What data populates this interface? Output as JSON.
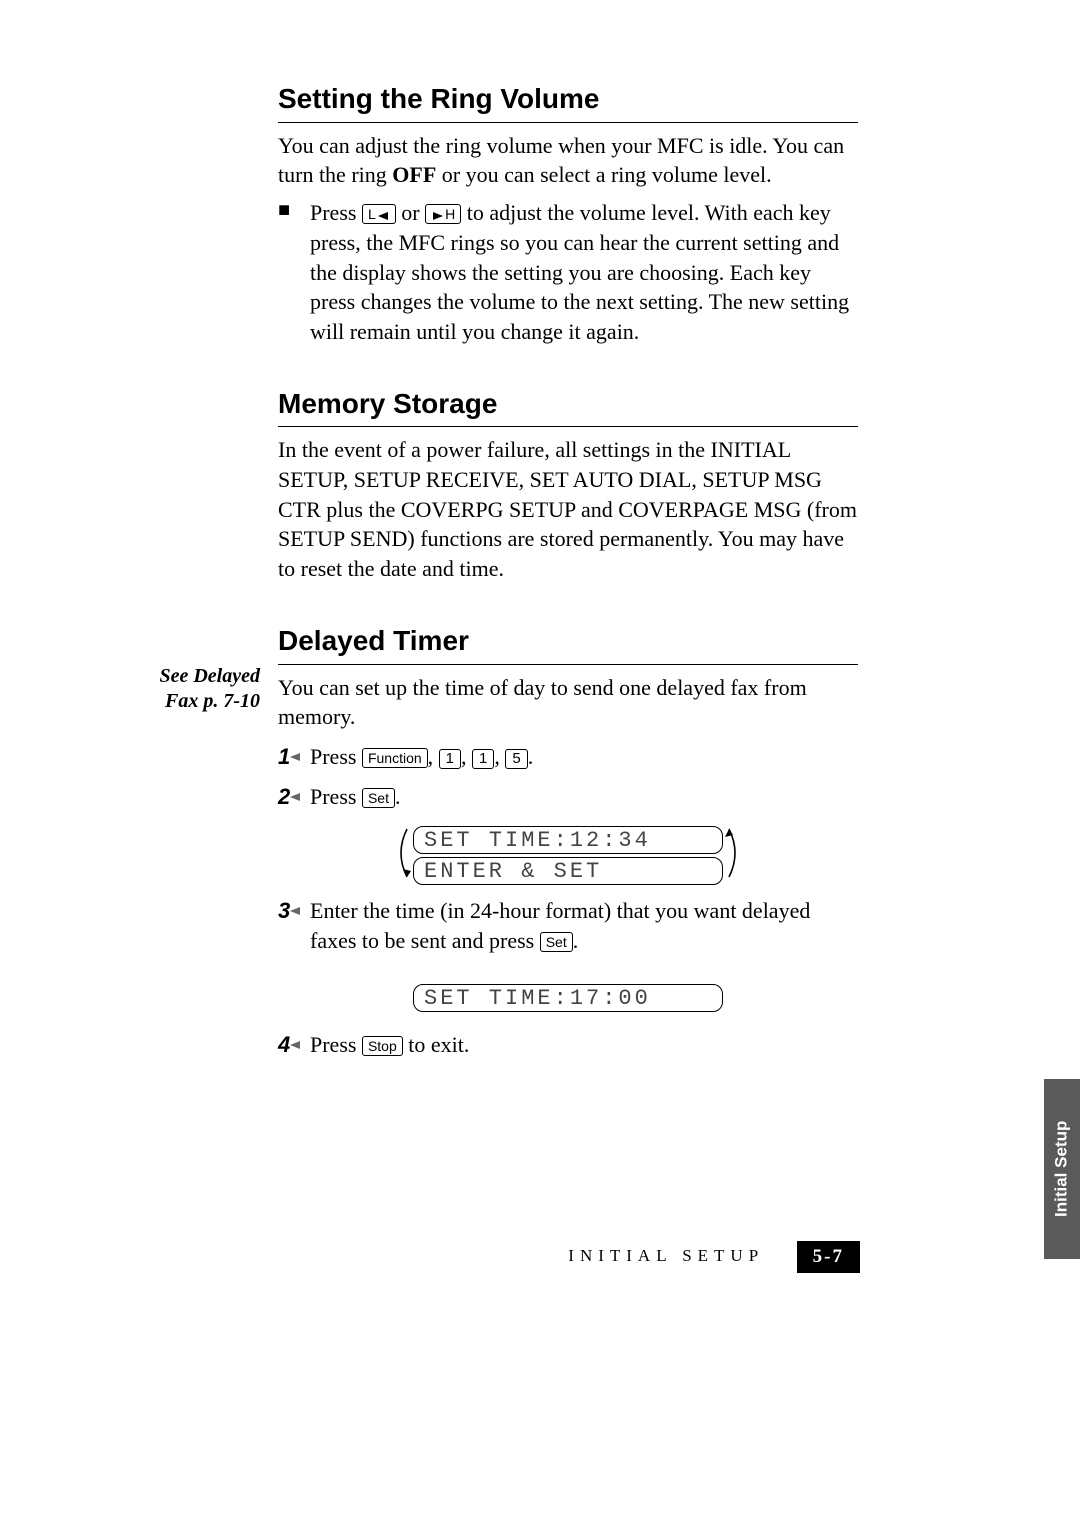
{
  "sections": {
    "ring": {
      "heading": "Setting the Ring Volume",
      "intro_a": "You can adjust the ring volume when your MFC is idle. You can turn the ring ",
      "intro_bold": "OFF",
      "intro_b": " or you can select a ring volume level.",
      "bullet_a": "Press ",
      "bullet_b": " or ",
      "bullet_c": " to adjust the volume level. With each key press, the MFC rings so you can hear the current setting and the display shows the setting you are choosing. Each key press changes the volume to the next setting. The new setting will remain until you change it again."
    },
    "memory": {
      "heading": "Memory Storage",
      "body": "In the event of a power failure, all settings in the INITIAL SETUP, SETUP RECEIVE, SET AUTO DIAL, SETUP MSG CTR plus the COVERPG SETUP and COVERPAGE MSG (from SETUP SEND) functions are stored  permanently. You may have to reset the date and time."
    },
    "delayed": {
      "heading": "Delayed Timer",
      "margin_note": "See Delayed Fax p. 7-10",
      "intro": "You can set up the time of day to send one delayed fax from memory.",
      "step1_a": "Press ",
      "step1_sep": ", ",
      "step1_end": ".",
      "step2_a": "Press ",
      "step2_end": ".",
      "lcd1": "SET TIME:12:34",
      "lcd2": "ENTER & SET",
      "step3_a": "Enter the time (in 24-hour format) that you want delayed faxes to be sent and press ",
      "step3_end": ".",
      "lcd3": "SET TIME:17:00",
      "step4_a": "Press ",
      "step4_b": " to exit."
    }
  },
  "keys": {
    "low": "L",
    "high": "H",
    "function": "Function",
    "one": "1",
    "five": "5",
    "set": "Set",
    "stop": "Stop"
  },
  "step_numbers": {
    "s1": "1",
    "s2": "2",
    "s3": "3",
    "s4": "4"
  },
  "footer": {
    "chapter": "INITIAL SETUP",
    "page": "5-7"
  },
  "side_tab": "Initial Setup"
}
